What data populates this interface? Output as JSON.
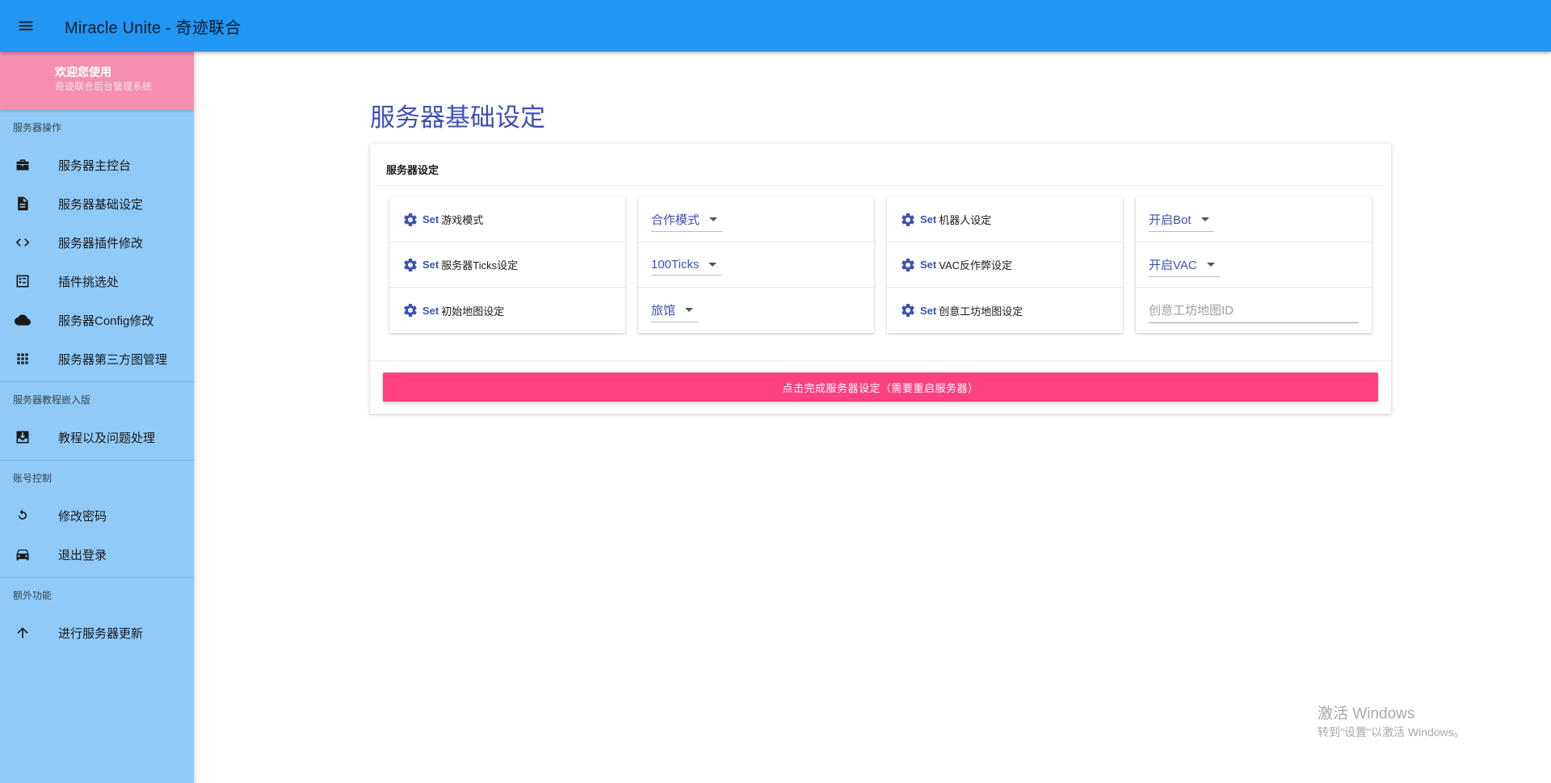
{
  "app": {
    "title": "Miracle Unite - 奇迹联合"
  },
  "sidebar": {
    "welcome_title": "欢迎您使用",
    "welcome_subtitle": "奇迹联合后台管理系统",
    "sections": [
      {
        "title": "服务器操作",
        "items": [
          {
            "label": "服务器主控台",
            "icon": "briefcase-icon"
          },
          {
            "label": "服务器基础设定",
            "icon": "document-icon"
          },
          {
            "label": "服务器插件修改",
            "icon": "code-icon"
          },
          {
            "label": "插件挑选处",
            "icon": "list-box-icon"
          },
          {
            "label": "服务器Config修改",
            "icon": "cloud-icon"
          },
          {
            "label": "服务器第三方图管理",
            "icon": "apps-grid-icon"
          }
        ]
      },
      {
        "title": "服务器教程嵌入版",
        "items": [
          {
            "label": "教程以及问题处理",
            "icon": "download-box-icon"
          }
        ]
      },
      {
        "title": "账号控制",
        "items": [
          {
            "label": "修改密码",
            "icon": "refresh-icon"
          },
          {
            "label": "退出登录",
            "icon": "car-icon"
          }
        ]
      },
      {
        "title": "额外功能",
        "items": [
          {
            "label": "进行服务器更新",
            "icon": "arrow-up-icon"
          }
        ]
      }
    ]
  },
  "main": {
    "page_title": "服务器基础设定",
    "card_title": "服务器设定",
    "set_keyword": "Set",
    "left_settings": [
      {
        "label": "游戏模式",
        "value": "合作模式"
      },
      {
        "label": "服务器Ticks设定",
        "value": "100Ticks"
      },
      {
        "label": "初始地图设定",
        "value": "旅馆"
      }
    ],
    "right_settings": [
      {
        "label": "机器人设定",
        "value": "开启Bot"
      },
      {
        "label": "VAC反作弊设定",
        "value": "开启VAC"
      },
      {
        "label": "创意工坊地图设定",
        "placeholder": "创意工坊地图ID"
      }
    ],
    "submit_label": "点击完成服务器设定（需要重启服务器）"
  },
  "watermark": {
    "line1": "激活 Windows",
    "line2": "转到\"设置\"以激活 Windows。"
  },
  "colors": {
    "topbar": "#2196f3",
    "sidebar": "#90caf9",
    "welcome": "#f48fb1",
    "accent": "#3f51b5",
    "button": "#ff4081"
  }
}
